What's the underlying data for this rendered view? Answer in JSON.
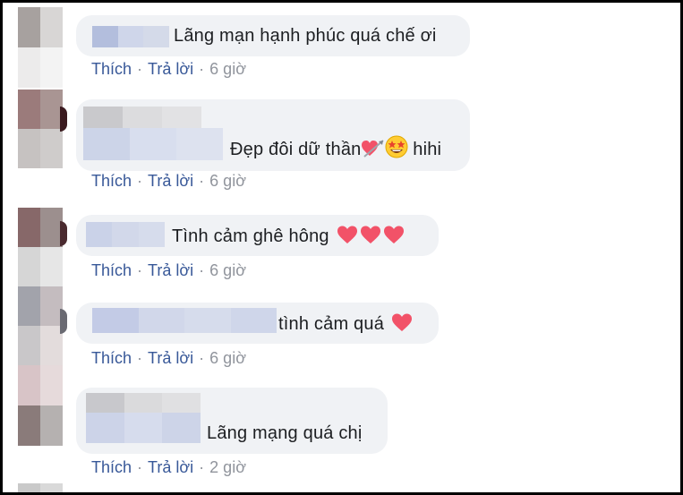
{
  "comments": [
    {
      "text": "Lãng mạn hạnh phúc quá chế ơi",
      "like": "Thích",
      "reply": "Trả lời",
      "time": "6 giờ"
    },
    {
      "text": "Đẹp đôi dữ thần",
      "suffix": "hihi",
      "emojis": [
        "heart-arrow-icon",
        "star-struck-icon"
      ],
      "like": "Thích",
      "reply": "Trả lời",
      "time": "6 giờ"
    },
    {
      "text": "Tình cảm ghê hông",
      "emojis": [
        "heart-icon",
        "heart-icon",
        "heart-icon"
      ],
      "like": "Thích",
      "reply": "Trả lời",
      "time": "6 giờ"
    },
    {
      "text": "tình cảm quá",
      "emojis": [
        "heart-icon"
      ],
      "like": "Thích",
      "reply": "Trả lời",
      "time": "6 giờ"
    },
    {
      "text": "Lãng mạng quá chị",
      "like": "Thích",
      "reply": "Trả lời",
      "time": "2 giờ"
    }
  ],
  "colors": {
    "link": "#385898",
    "meta": "#90949c",
    "bubble": "#f0f2f5",
    "heart": "#f25268"
  }
}
